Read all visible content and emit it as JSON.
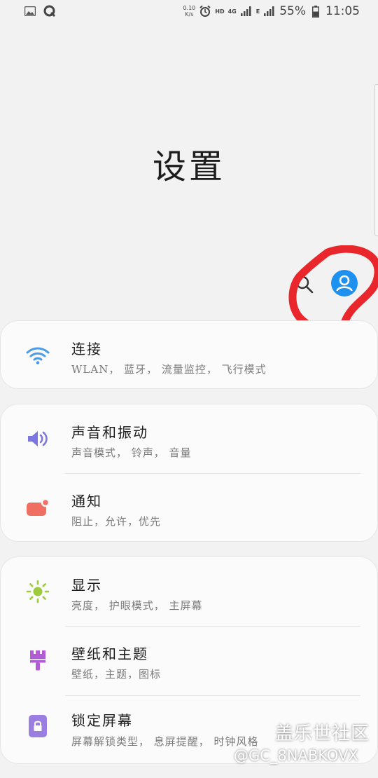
{
  "status_bar": {
    "net_speed_value": "0.10",
    "net_speed_unit": "K/s",
    "hd_label": "HD",
    "network_4g": "4G",
    "network_e": "E",
    "battery": "55%",
    "time": "11:05",
    "icons": [
      "gallery-icon",
      "q-app-icon",
      "alarm-icon",
      "signal-icon",
      "battery-icon"
    ]
  },
  "page": {
    "title": "设置"
  },
  "header_actions": {
    "search_icon": "search-icon",
    "account_icon": "account-icon"
  },
  "settings": [
    [
      {
        "title": "连接",
        "subtitle": "WLAN， 蓝牙， 流量监控， 飞行模式",
        "icon": "wifi-icon",
        "icon_color": "#4a9be8"
      }
    ],
    [
      {
        "title": "声音和振动",
        "subtitle": "声音模式， 铃声， 音量",
        "icon": "volume-icon",
        "icon_color": "#7b76e0"
      },
      {
        "title": "通知",
        "subtitle": "阻止，允许，优先",
        "icon": "notification-icon",
        "icon_color": "#ef7063"
      }
    ],
    [
      {
        "title": "显示",
        "subtitle": "亮度， 护眼模式， 主屏幕",
        "icon": "brightness-icon",
        "icon_color": "#9ccc3c"
      },
      {
        "title": "壁纸和主题",
        "subtitle": "壁纸，主题，图标",
        "icon": "theme-brush-icon",
        "icon_color": "#b35ad6"
      },
      {
        "title": "锁定屏幕",
        "subtitle": "屏幕解锁类型， 息屏提醒， 时钟风格",
        "icon": "lock-icon",
        "icon_color": "#9a7ee0"
      }
    ]
  ],
  "watermark": {
    "line1": "盖乐世社区",
    "line2": "@GC_8NABKOVX"
  }
}
